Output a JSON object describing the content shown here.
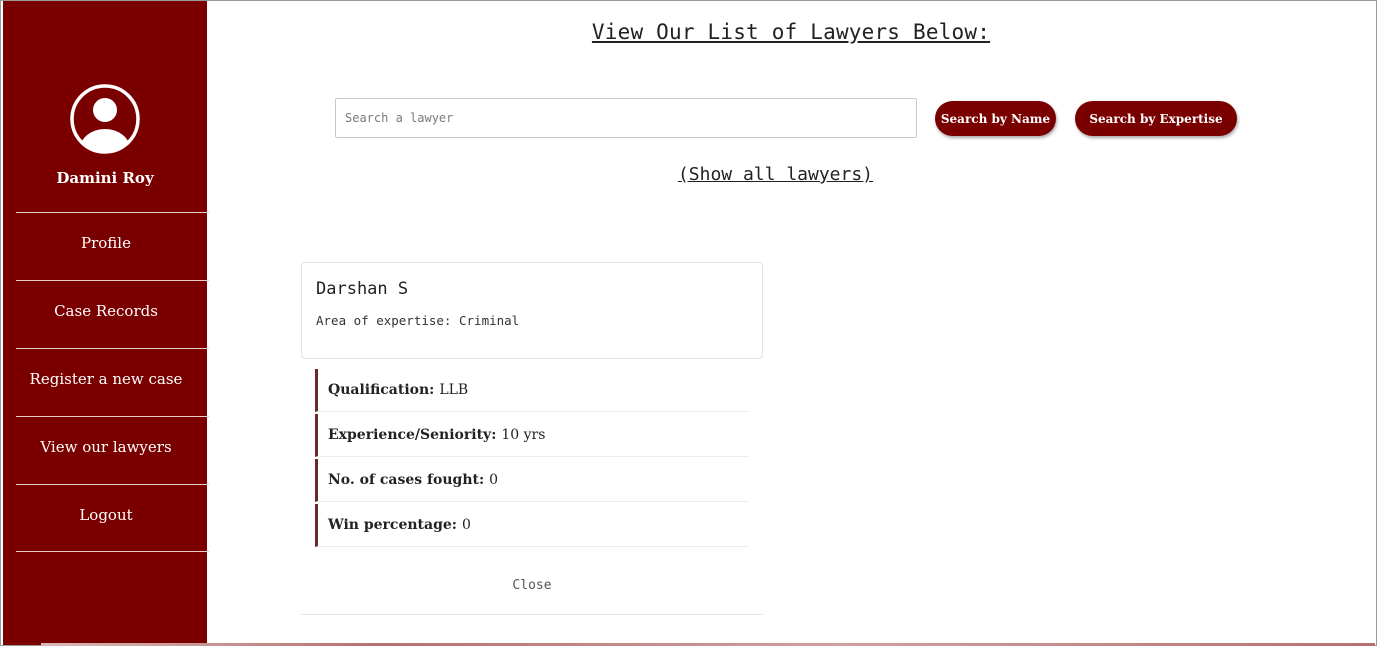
{
  "sidebar": {
    "user_name": "Damini Roy",
    "avatar_icon": "user-avatar-icon",
    "items": [
      {
        "label": "Profile"
      },
      {
        "label": "Case Records"
      },
      {
        "label": "Register a new case"
      },
      {
        "label": "View our lawyers"
      },
      {
        "label": "Logout"
      }
    ],
    "color": "#7a0000"
  },
  "main": {
    "title": "View Our List of Lawyers Below:",
    "search": {
      "placeholder": "Search a lawyer",
      "value": ""
    },
    "buttons": {
      "search_by_name": "Search by Name",
      "search_by_expertise": "Search by Expertise"
    },
    "show_all_label": "(Show all lawyers)",
    "lawyer": {
      "name": "Darshan S",
      "expertise_label": "Area of expertise:",
      "expertise_value": "Criminal",
      "details": [
        {
          "label": "Qualification:",
          "value": "LLB"
        },
        {
          "label": "Experience/Seniority:",
          "value": "10 yrs"
        },
        {
          "label": "No. of cases fought:",
          "value": "0"
        },
        {
          "label": "Win percentage:",
          "value": "0"
        }
      ],
      "close_label": "Close"
    }
  }
}
